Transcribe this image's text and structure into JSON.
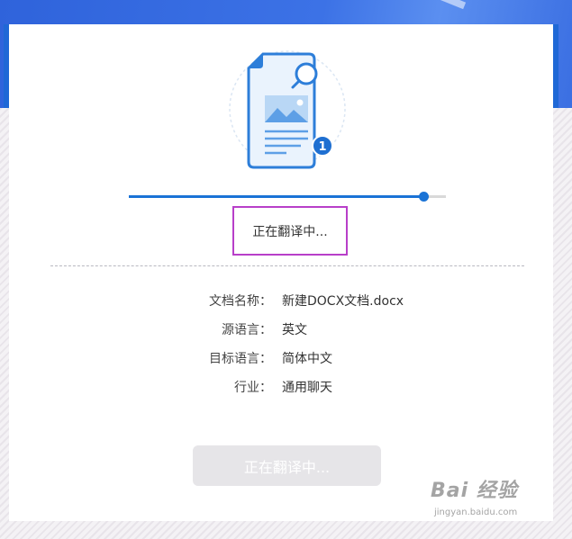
{
  "translation": {
    "status_text": "正在翻译中...",
    "progress_fraction": 0.93,
    "badge_number": "1"
  },
  "document_info": {
    "rows": [
      {
        "label": "文档名称：",
        "value": "新建DOCX文档.docx"
      },
      {
        "label": "源语言：",
        "value": "英文"
      },
      {
        "label": "目标语言：",
        "value": "简体中文"
      },
      {
        "label": "行业：",
        "value": "通用聊天"
      }
    ]
  },
  "action_button": {
    "label": "正在翻译中..."
  },
  "watermark": {
    "logo_text": "Bai 经验",
    "url": "jingyan.baidu.com"
  },
  "colors": {
    "accent": "#1a73d6",
    "banner": "#2f63db",
    "highlight_box": "#b83fc9",
    "button_disabled": "#e6e5e8"
  }
}
